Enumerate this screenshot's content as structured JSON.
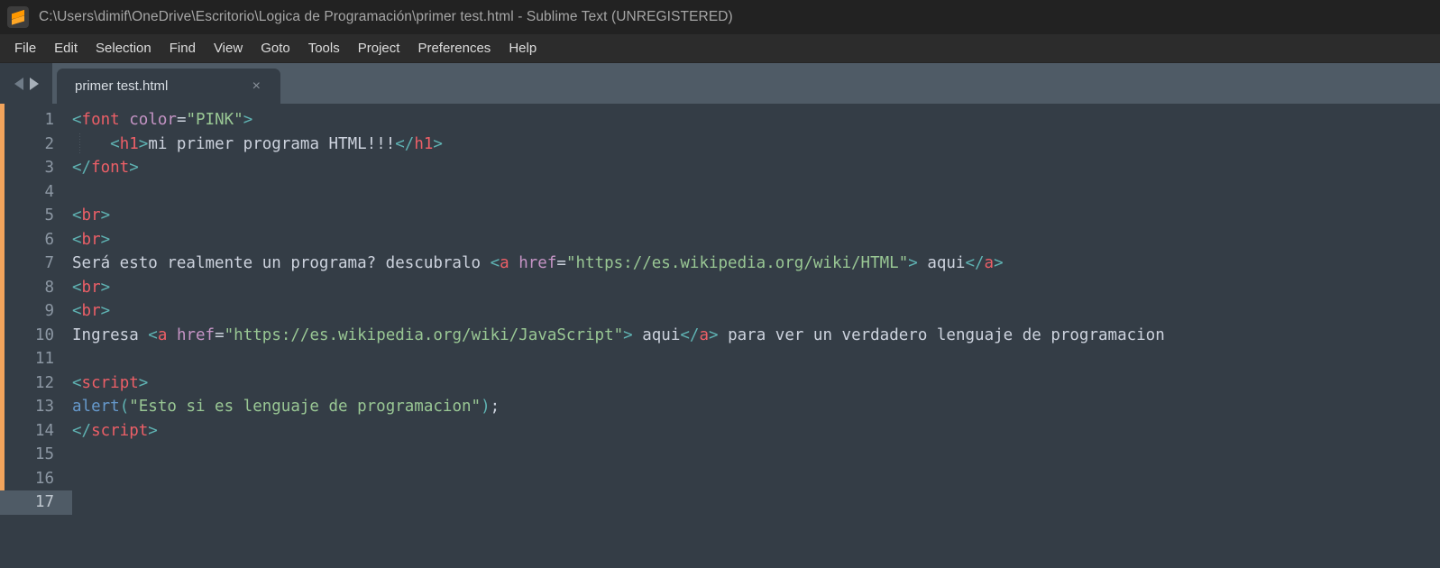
{
  "window": {
    "logo_icon": "sublime-text-logo",
    "title": "C:\\Users\\dimif\\OneDrive\\Escritorio\\Logica de Programación\\primer test.html - Sublime Text (UNREGISTERED)"
  },
  "menubar": {
    "items": [
      {
        "label": "File"
      },
      {
        "label": "Edit"
      },
      {
        "label": "Selection"
      },
      {
        "label": "Find"
      },
      {
        "label": "View"
      },
      {
        "label": "Goto"
      },
      {
        "label": "Tools"
      },
      {
        "label": "Project"
      },
      {
        "label": "Preferences"
      },
      {
        "label": "Help"
      }
    ]
  },
  "tabbar": {
    "prev_icon": "arrow-left-icon",
    "next_icon": "arrow-right-icon",
    "tabs": [
      {
        "label": "primer test.html",
        "close_label": "×",
        "active": true
      }
    ]
  },
  "editor": {
    "active_line": 17,
    "total_lines": 17,
    "line_numbers": [
      "1",
      "2",
      "3",
      "4",
      "5",
      "6",
      "7",
      "8",
      "9",
      "10",
      "11",
      "12",
      "13",
      "14",
      "15",
      "16",
      "17"
    ],
    "lines": [
      {
        "n": "1",
        "text": "<font color=\"PINK\">"
      },
      {
        "n": "2",
        "text": "    <h1>mi primer programa HTML!!!</h1>"
      },
      {
        "n": "3",
        "text": "</font>"
      },
      {
        "n": "4",
        "text": ""
      },
      {
        "n": "5",
        "text": "<br>"
      },
      {
        "n": "6",
        "text": "<br>"
      },
      {
        "n": "7",
        "text": "Será esto realmente un programa? descubralo <a href=\"https://es.wikipedia.org/wiki/HTML\"> aqui</a>"
      },
      {
        "n": "8",
        "text": "<br>"
      },
      {
        "n": "9",
        "text": "<br>"
      },
      {
        "n": "10",
        "text": "Ingresa <a href=\"https://es.wikipedia.org/wiki/JavaScript\"> aqui</a> para ver un verdadero lenguaje de programacion"
      },
      {
        "n": "11",
        "text": ""
      },
      {
        "n": "12",
        "text": "<script>"
      },
      {
        "n": "13",
        "text": "alert(\"Esto si es lenguaje de programacion\");"
      },
      {
        "n": "14",
        "text": "</script>"
      },
      {
        "n": "15",
        "text": ""
      },
      {
        "n": "16",
        "text": ""
      },
      {
        "n": "17",
        "text": ""
      }
    ]
  },
  "colors": {
    "background": "#343d46",
    "titlebar": "#222222",
    "menubar": "#2c2c2c",
    "tabbar": "#4f5b66",
    "accent": "#f2a45c",
    "punctuation": "#5fb3b3",
    "tag": "#ec5f67",
    "attribute": "#c594c5",
    "string": "#99c794",
    "text": "#cdd3de",
    "function": "#6699cc",
    "line_number": "#8c97a3"
  }
}
